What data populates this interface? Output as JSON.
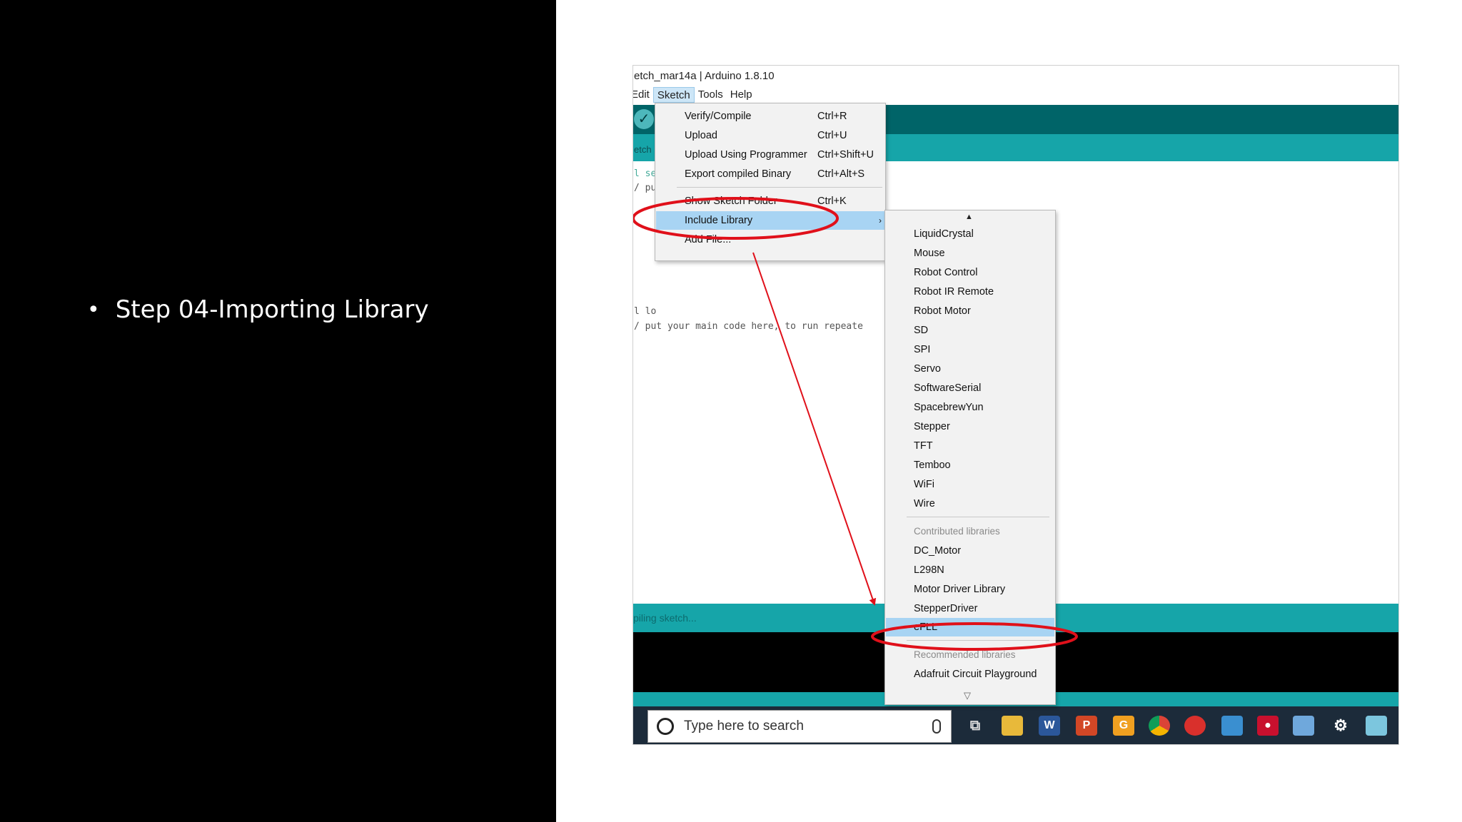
{
  "slide": {
    "bullet_text": "Step 04-Importing Library",
    "bullet_symbol": "•"
  },
  "window": {
    "title": "etch_mar14a | Arduino 1.8.10",
    "menu": [
      "Edit",
      "Sketch",
      "Tools",
      "Help"
    ],
    "menu_display": [
      "Edit",
      "Sketch",
      "Tools",
      "Help"
    ],
    "active_menu": "Sketch"
  },
  "editor": {
    "tab_label": "etch",
    "lines": [
      "l se",
      "/ pu",
      "l lo",
      "/ put your main code here, to run repeate"
    ],
    "status_text": "piling sketch..."
  },
  "sketch_menu": {
    "items": [
      {
        "label": "Verify/Compile",
        "shortcut": "Ctrl+R"
      },
      {
        "label": "Upload",
        "shortcut": "Ctrl+U"
      },
      {
        "label": "Upload Using Programmer",
        "shortcut": "Ctrl+Shift+U"
      },
      {
        "label": "Export compiled Binary",
        "shortcut": "Ctrl+Alt+S"
      },
      {
        "label": "Show Sketch Folder",
        "shortcut": "Ctrl+K"
      },
      {
        "label": "Include Library",
        "shortcut": ""
      },
      {
        "label": "Add File...",
        "shortcut": ""
      }
    ],
    "highlighted": "Include Library"
  },
  "library_menu": {
    "scroll_up": "▲",
    "scroll_down": "▽",
    "builtin": [
      "LiquidCrystal",
      "Mouse",
      "Robot Control",
      "Robot IR Remote",
      "Robot Motor",
      "SD",
      "SPI",
      "Servo",
      "SoftwareSerial",
      "SpacebrewYun",
      "Stepper",
      "TFT",
      "Temboo",
      "WiFi",
      "Wire"
    ],
    "contributed_header": "Contributed libraries",
    "contributed": [
      "DC_Motor",
      "L298N",
      "Motor Driver Library",
      "StepperDriver",
      "eFLL"
    ],
    "recommended_header": "Recommended libraries",
    "recommended": [
      "Adafruit Circuit Playground"
    ],
    "highlighted": "eFLL"
  },
  "taskbar": {
    "search_placeholder": "Type here to search",
    "icons": [
      "task-view-icon",
      "file-explorer-icon",
      "word-icon",
      "powerpoint-icon",
      "app-orange-icon",
      "chrome-icon",
      "app-red-icon",
      "arduino-icon",
      "app-red2-icon",
      "app-cube-icon",
      "settings-icon",
      "app-last-icon"
    ]
  },
  "colors": {
    "teal_dark": "#006468",
    "teal": "#16a5a9",
    "annotation_red": "#e0101a",
    "highlight": "#a8d4f3"
  }
}
